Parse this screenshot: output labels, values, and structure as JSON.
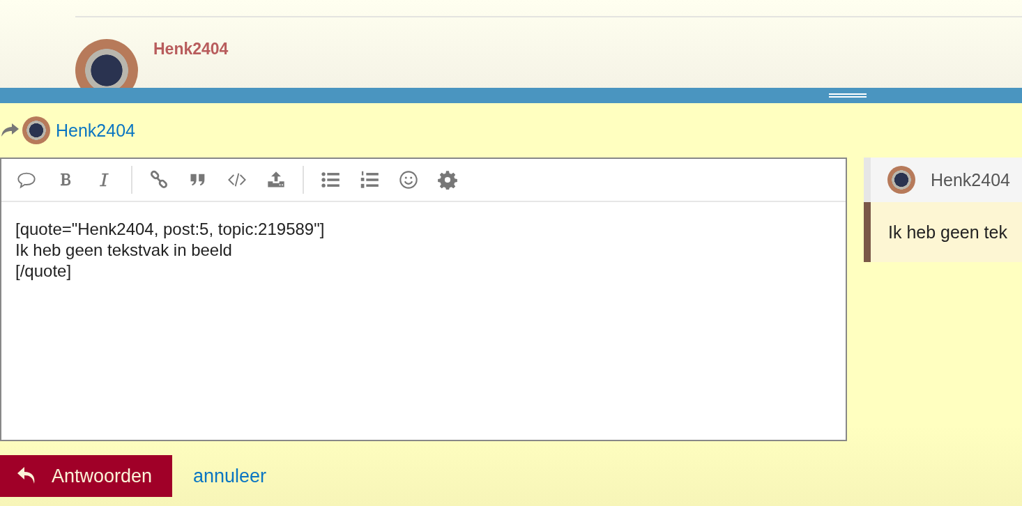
{
  "post_header": {
    "username": "Henk2404"
  },
  "reply_to": {
    "username": "Henk2404"
  },
  "editor": {
    "value": "[quote=\"Henk2404, post:5, topic:219589\"]\nIk heb geen tekstvak in beeld\n[/quote]"
  },
  "preview": {
    "quote_author": "Henk2404",
    "quote_text": "Ik heb geen tek"
  },
  "actions": {
    "submit": "Antwoorden",
    "cancel": "annuleer"
  }
}
